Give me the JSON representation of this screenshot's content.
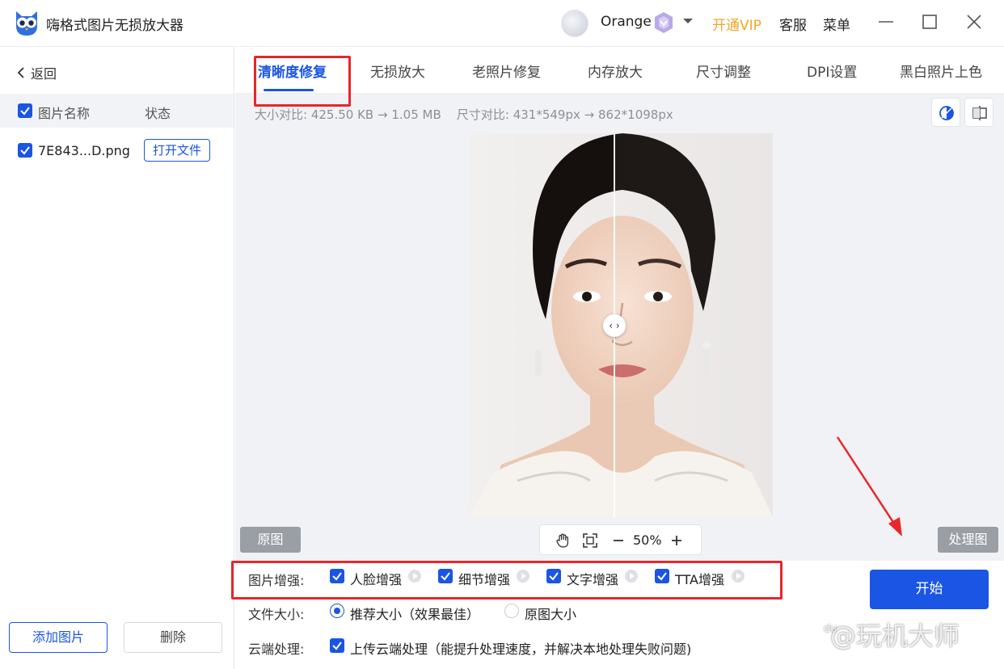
{
  "app": {
    "title": "嗨格式图片无损放大器",
    "username": "Orange",
    "vip_link": "开通VIP",
    "service": "客服",
    "menu": "菜单"
  },
  "sidebar": {
    "back": "返回",
    "header": {
      "name": "图片名称",
      "status": "状态"
    },
    "files": [
      {
        "name": "7E843...D.png",
        "action": "打开文件"
      }
    ],
    "add_button": "添加图片",
    "delete_button": "删除"
  },
  "tabs": [
    {
      "label": "清晰度修复",
      "active": true
    },
    {
      "label": "无损放大"
    },
    {
      "label": "老照片修复"
    },
    {
      "label": "内存放大"
    },
    {
      "label": "尺寸调整"
    },
    {
      "label": "DPI设置"
    },
    {
      "label": "黑白照片上色"
    }
  ],
  "compare": {
    "size_label": "大小对比:",
    "size_before": "425.50 KB",
    "size_after": "1.05 MB",
    "dim_label": "尺寸对比:",
    "dim_before": "431*549px",
    "dim_after": "862*1098px"
  },
  "preview": {
    "original_label": "原图",
    "processed_label": "处理图",
    "zoom": "50%"
  },
  "options": {
    "enhance_label": "图片增强:",
    "enhance_items": [
      "人脸增强",
      "细节增强",
      "文字增强",
      "TTA增强"
    ],
    "size_label": "文件大小:",
    "size_recommended": "推荐大小（效果最佳）",
    "size_original": "原图大小",
    "cloud_label": "云端处理:",
    "cloud_text": "上传云端处理（能提升处理速度，并解决本地处理失败问题)"
  },
  "start_button": "开始",
  "watermark": "@玩机大师",
  "colors": {
    "accent": "#1a55e3",
    "vip": "#f5a623",
    "highlight": "#e8262b"
  }
}
